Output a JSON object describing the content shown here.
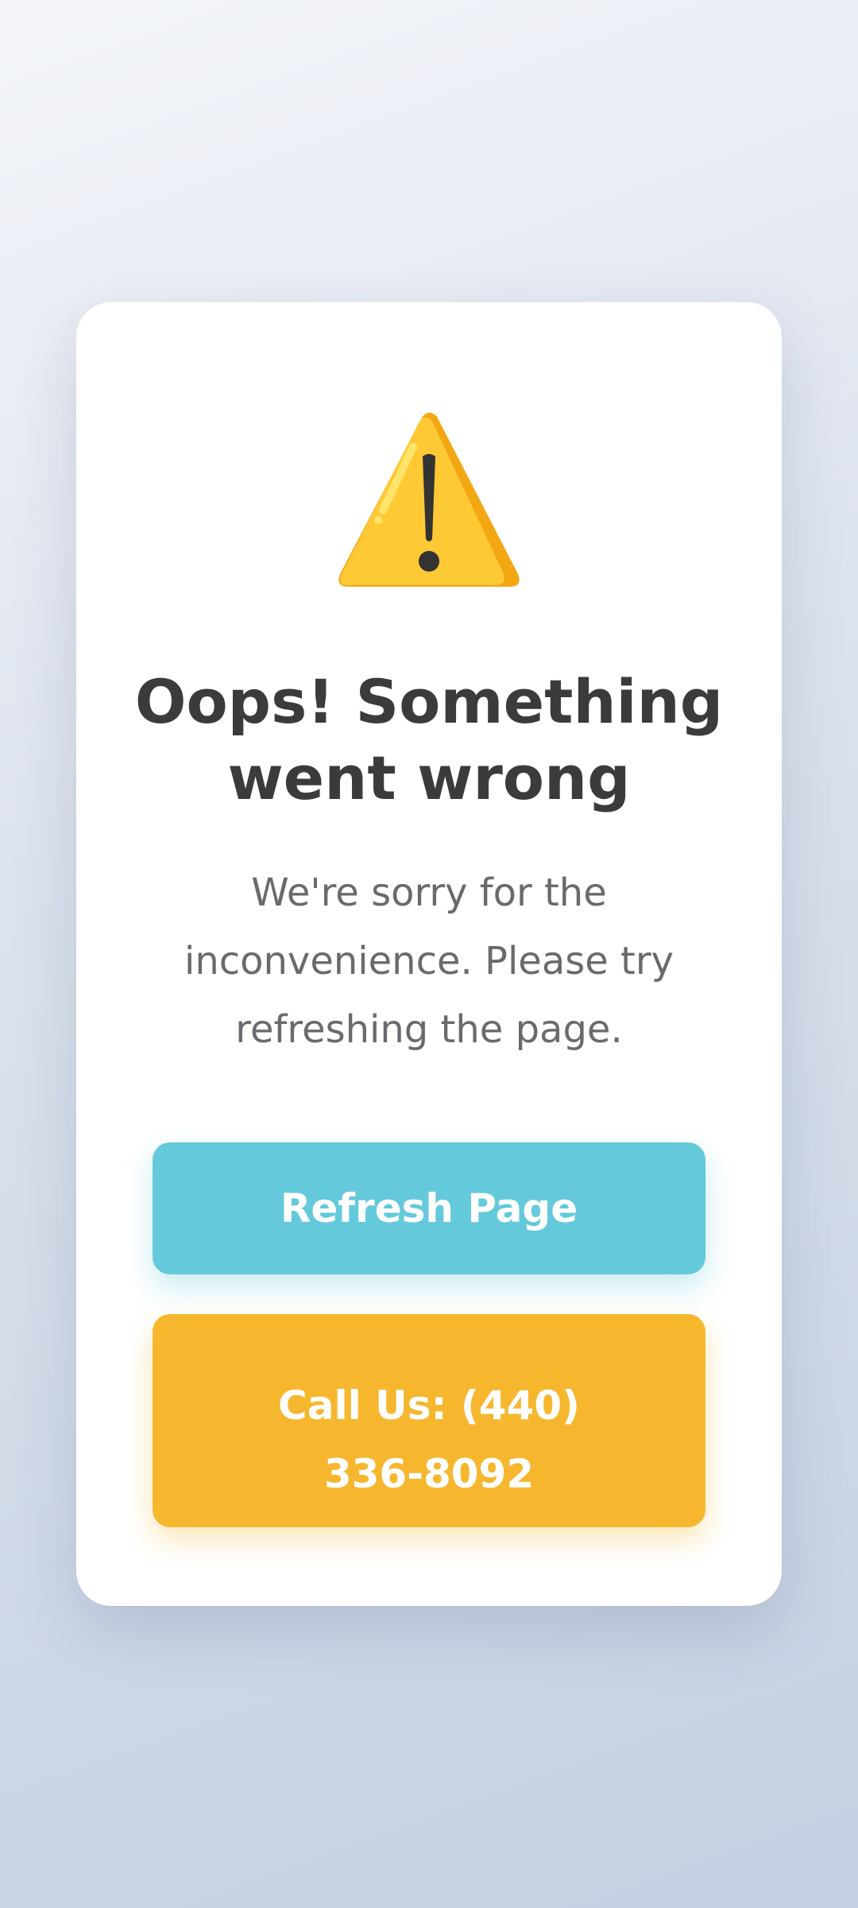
{
  "error_card": {
    "icon": "warning-triangle-icon",
    "title": "Oops! Something went wrong",
    "message": "We're sorry for the inconvenience. Please try refreshing the page."
  },
  "actions": {
    "refresh_label": "Refresh Page",
    "call_label": "Call Us: (440) 336-8092"
  },
  "colors": {
    "refresh_button": "#63c9db",
    "call_button": "#f6b72f",
    "warning_icon": "#ffc935",
    "title_text": "#3b3b3d",
    "message_text": "#6a6a6e"
  }
}
